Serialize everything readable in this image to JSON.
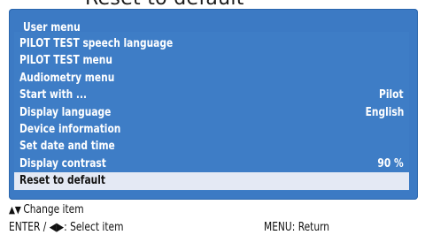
{
  "top_partial_text": "Reset to default",
  "panel": {
    "title": "User menu"
  },
  "menu_items": [
    {
      "label": "PILOT TEST speech language",
      "value": ""
    },
    {
      "label": "PILOT TEST menu",
      "value": ""
    },
    {
      "label": "Audiometry menu",
      "value": ""
    },
    {
      "label": "Start with ...",
      "value": "Pilot"
    },
    {
      "label": "Display language",
      "value": "English"
    },
    {
      "label": "Device information",
      "value": ""
    },
    {
      "label": "Set date and time",
      "value": ""
    },
    {
      "label": "Display contrast",
      "value": "90 %"
    },
    {
      "label": "Reset to default",
      "value": "",
      "selected": true
    }
  ],
  "help": {
    "change_item_icons": "▲▼",
    "change_item": "Change item",
    "select_item": "ENTER / ◀▶: Select item",
    "return": "MENU: Return"
  }
}
